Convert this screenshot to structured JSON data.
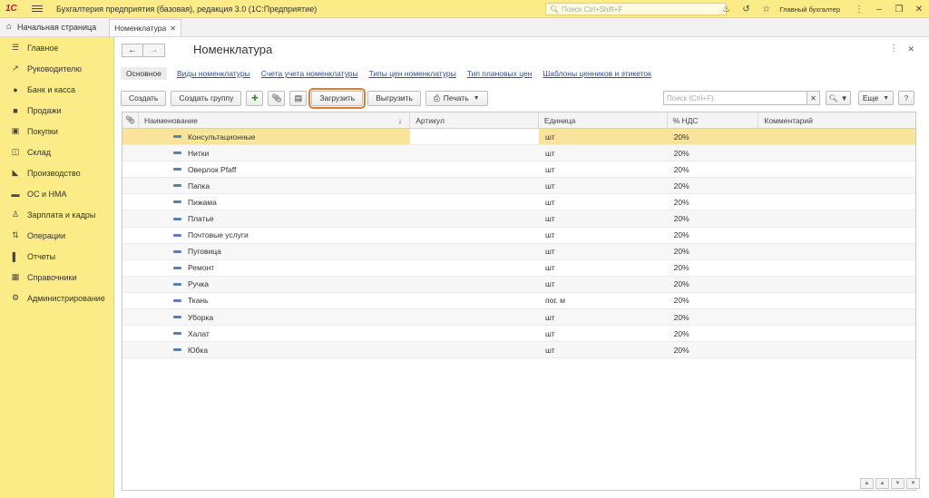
{
  "titlebar": {
    "logo": "1С",
    "app_title": "Бухгалтерия предприятия (базовая), редакция 3.0  (1С:Предприятие)",
    "search_placeholder": "Поиск Ctrl+Shift+F",
    "user": "Главный бухгалтер"
  },
  "tabs": {
    "home": "Начальная страница",
    "active": "Номенклатура"
  },
  "sidebar": {
    "items": [
      {
        "label": "Главное",
        "icon": "menu-icon"
      },
      {
        "label": "Руководителю",
        "icon": "trend-icon"
      },
      {
        "label": "Банк и касса",
        "icon": "coin-icon"
      },
      {
        "label": "Продажи",
        "icon": "bag-icon"
      },
      {
        "label": "Покупки",
        "icon": "cart-icon"
      },
      {
        "label": "Склад",
        "icon": "box-icon"
      },
      {
        "label": "Производство",
        "icon": "factory-icon"
      },
      {
        "label": "ОС и НМА",
        "icon": "truck-icon"
      },
      {
        "label": "Зарплата и кадры",
        "icon": "person-icon"
      },
      {
        "label": "Операции",
        "icon": "dtkt-icon"
      },
      {
        "label": "Отчеты",
        "icon": "chart-icon"
      },
      {
        "label": "Справочники",
        "icon": "book-icon"
      },
      {
        "label": "Администрирование",
        "icon": "gear-icon"
      }
    ]
  },
  "form": {
    "title": "Номенклатура",
    "links": {
      "main": "Основное",
      "items": [
        "Виды номенклатуры",
        "Счета учета номенклатуры",
        "Типы цен номенклатуры",
        "Тип плановых цен",
        "Шаблоны ценников и этикеток"
      ]
    },
    "toolbar": {
      "create": "Создать",
      "create_group": "Создать группу",
      "load": "Загрузить",
      "unload": "Выгрузить",
      "print": "Печать",
      "search_placeholder": "Поиск (Ctrl+F)",
      "more": "Еще",
      "help": "?"
    }
  },
  "table": {
    "columns": [
      "Наименование",
      "Артикул",
      "Единица",
      "% НДС",
      "Комментарий"
    ],
    "rows": [
      {
        "name": "Консультационные",
        "article": "",
        "unit": "шт",
        "vat": "20%",
        "comment": ""
      },
      {
        "name": "Нитки",
        "article": "",
        "unit": "шт",
        "vat": "20%",
        "comment": ""
      },
      {
        "name": "Оверлок Pfaff",
        "article": "",
        "unit": "шт",
        "vat": "20%",
        "comment": ""
      },
      {
        "name": "Папка",
        "article": "",
        "unit": "шт",
        "vat": "20%",
        "comment": ""
      },
      {
        "name": "Пижама",
        "article": "",
        "unit": "шт",
        "vat": "20%",
        "comment": ""
      },
      {
        "name": "Платье",
        "article": "",
        "unit": "шт",
        "vat": "20%",
        "comment": ""
      },
      {
        "name": "Почтовые услуги",
        "article": "",
        "unit": "шт",
        "vat": "20%",
        "comment": ""
      },
      {
        "name": "Пуговица",
        "article": "",
        "unit": "шт",
        "vat": "20%",
        "comment": ""
      },
      {
        "name": "Ремонт",
        "article": "",
        "unit": "шт",
        "vat": "20%",
        "comment": ""
      },
      {
        "name": "Ручка",
        "article": "",
        "unit": "шт",
        "vat": "20%",
        "comment": ""
      },
      {
        "name": "Ткань",
        "article": "",
        "unit": "пог. м",
        "vat": "20%",
        "comment": ""
      },
      {
        "name": "Уборка",
        "article": "",
        "unit": "шт",
        "vat": "20%",
        "comment": ""
      },
      {
        "name": "Халат",
        "article": "",
        "unit": "шт",
        "vat": "20%",
        "comment": ""
      },
      {
        "name": "Юбка",
        "article": "",
        "unit": "шт",
        "vat": "20%",
        "comment": ""
      }
    ]
  },
  "colors": {
    "accent_yellow": "#fbec88",
    "selection": "#fbe39b",
    "highlight_outline": "#e07b2a",
    "link": "#2b4f9e"
  }
}
